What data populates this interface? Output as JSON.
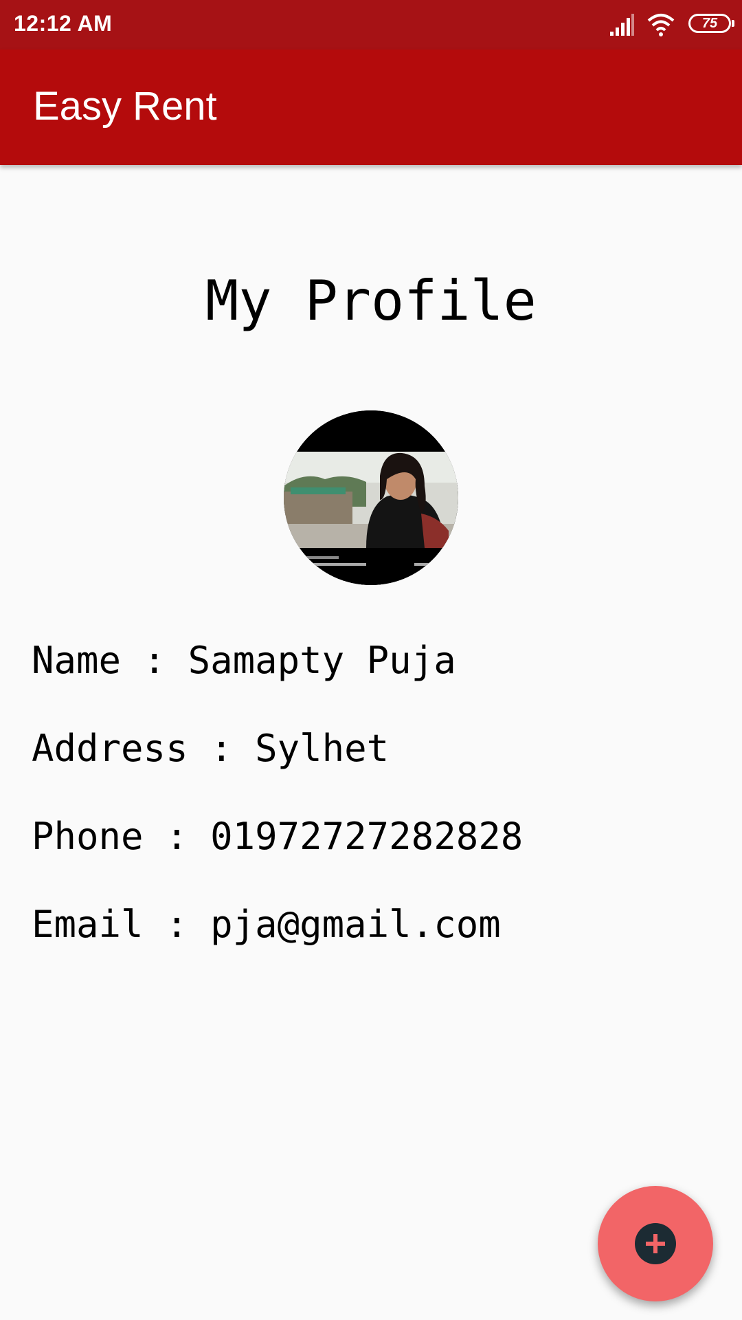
{
  "status_bar": {
    "time": "12:12 AM",
    "battery_level": "75",
    "icons": [
      "signal-icon",
      "wifi-icon",
      "battery-icon"
    ]
  },
  "app_bar": {
    "title": "Easy Rent",
    "color": "#b40b0c"
  },
  "profile": {
    "heading": "My Profile",
    "name_text": "Name : Samapty Puja",
    "address_text": "Address : Sylhet",
    "phone_text": "Phone : 01972727282828",
    "email_text": "Email : pja@gmail.com"
  },
  "fab": {
    "icon": "add-icon",
    "color": "#f26567"
  }
}
